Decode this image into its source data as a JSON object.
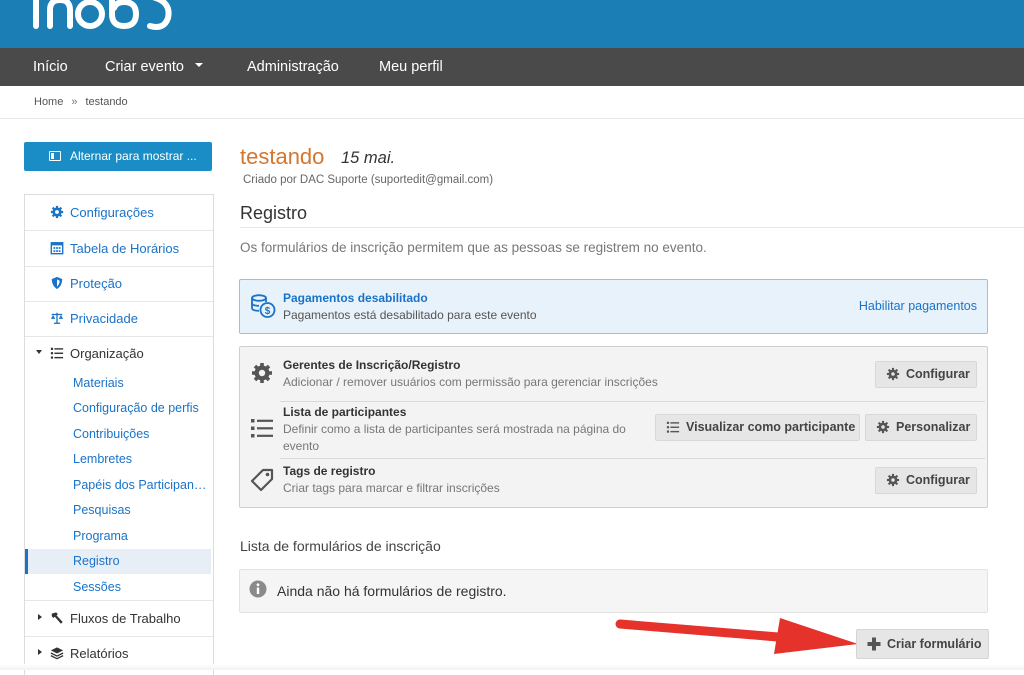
{
  "header": {
    "logo_text": "Inóbo",
    "brand_color": "#1b7fb5"
  },
  "nav": {
    "items": [
      "Início",
      "Criar evento",
      "Administração",
      "Meu perfil"
    ]
  },
  "breadcrumb": {
    "home": "Home",
    "separator": "»",
    "current": "testando"
  },
  "sidebar": {
    "toggle_label": "Alternar para mostrar ...",
    "items": [
      {
        "label": "Configurações",
        "icon": "gear-icon"
      },
      {
        "label": "Tabela de Horários",
        "icon": "calendar-icon"
      },
      {
        "label": "Proteção",
        "icon": "shield-icon"
      },
      {
        "label": "Privacidade",
        "icon": "scale-icon"
      },
      {
        "label": "Organização",
        "icon": "list-icon"
      }
    ],
    "sub_items": [
      "Materiais",
      "Configuração de perfis",
      "Contribuições",
      "Lembretes",
      "Papéis dos Participantes",
      "Pesquisas",
      "Programa",
      "Registro",
      "Sessões"
    ],
    "active_sub": "Registro",
    "bottom_items": [
      {
        "label": "Fluxos de Trabalho",
        "icon": "hammer-icon"
      },
      {
        "label": "Relatórios",
        "icon": "layers-icon"
      }
    ]
  },
  "event": {
    "title": "testando",
    "date": "15 mai.",
    "created_by": "Criado por DAC Suporte (suportedit@gmail.com)"
  },
  "registration": {
    "title": "Registro",
    "description": "Os formulários de inscrição permitem que as pessoas se registrem no evento."
  },
  "payments": {
    "title": "Pagamentos desabilitado",
    "subtitle": "Pagamentos está desabilitado para este evento",
    "link": "Habilitar pagamentos"
  },
  "managers": [
    {
      "title": "Gerentes de Inscrição/Registro",
      "subtitle": "Adicionar / remover usuários com permissão para gerenciar inscrições",
      "icon": "gear-icon",
      "buttons": [
        "Configurar"
      ]
    },
    {
      "title": "Lista de participantes",
      "subtitle": "Definir como a lista de participantes será mostrada na página do evento",
      "icon": "list-icon",
      "buttons": [
        "Visualizar como participante",
        "Personalizar"
      ]
    },
    {
      "title": "Tags de registro",
      "subtitle": "Criar tags para marcar e filtrar inscrições",
      "icon": "tag-icon",
      "buttons": [
        "Configurar"
      ]
    }
  ],
  "forms": {
    "title": "Lista de formulários de inscrição",
    "empty_text": "Ainda não há formulários de registro.",
    "create_button": "Criar formulário"
  },
  "annotation": {
    "arrow_color": "#e5322b"
  }
}
